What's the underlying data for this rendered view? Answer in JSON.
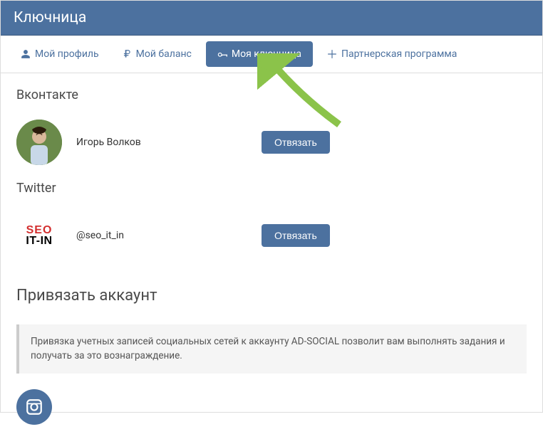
{
  "header": {
    "title": "Ключница"
  },
  "tabs": {
    "profile": "Мой профиль",
    "balance": "Мой баланс",
    "keyring": "Моя ключница",
    "partner": "Партнерская программа"
  },
  "sections": {
    "vk": {
      "title": "Вконтакте",
      "account_name": "Игорь Волков",
      "unlink_label": "Отвязать"
    },
    "twitter": {
      "title": "Twitter",
      "logo_top": "SEO",
      "logo_bottom": "IT-IN",
      "account_name": "@seo_it_in",
      "unlink_label": "Отвязать"
    }
  },
  "link_section": {
    "title": "Привязать аккаунт",
    "info": "Привязка учетных записей социальных сетей к аккаунту AD-SOCIAL позволит вам выполнять задания и получать за это вознаграждение."
  }
}
